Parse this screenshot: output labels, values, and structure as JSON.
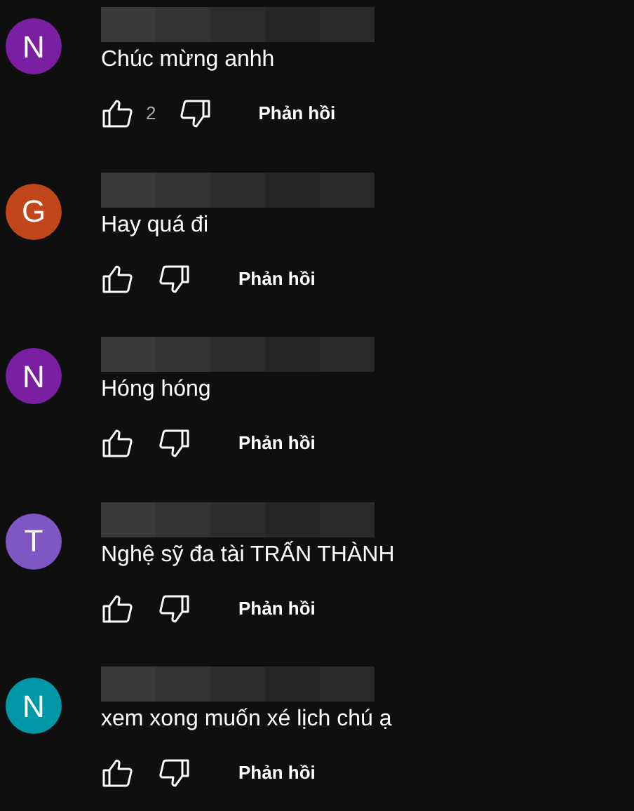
{
  "comments": [
    {
      "initial": "N",
      "color": "#7b1fa2",
      "name_hidden": true,
      "text": "Chúc mừng anhh",
      "likes": "2",
      "reply": "Phản hồi"
    },
    {
      "initial": "G",
      "color": "#c1461c",
      "name_hidden": true,
      "text": "Hay quá đi",
      "reply": "Phản hồi"
    },
    {
      "initial": "N",
      "color": "#7b1fa2",
      "name_hidden": true,
      "text": "Hóng hóng",
      "reply": "Phản hồi"
    },
    {
      "initial": "T",
      "color": "#7e57c2",
      "name_hidden": true,
      "text": "Nghệ sỹ đa tài TRẤN THÀNH",
      "reply": "Phản hồi"
    },
    {
      "initial": "N",
      "color": "#0097a7",
      "name_hidden": true,
      "text": "xem xong muốn xé lịch chú ạ",
      "reply": "Phản hồi"
    }
  ]
}
